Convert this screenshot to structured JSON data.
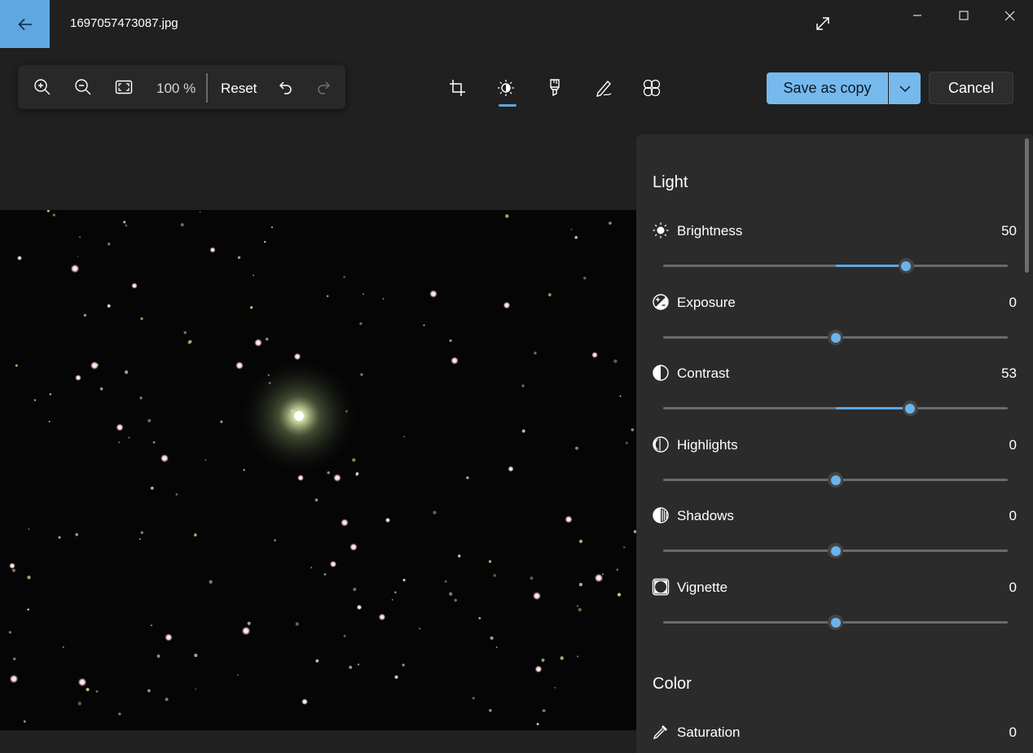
{
  "window": {
    "file_name": "1697057473087.jpg"
  },
  "toolbar": {
    "zoom_level": "100 %",
    "reset_label": "Reset"
  },
  "tabs": [
    {
      "icon": "crop-icon",
      "selected": false
    },
    {
      "icon": "adjust-icon",
      "selected": true
    },
    {
      "icon": "markup-icon",
      "selected": false
    },
    {
      "icon": "retouch-icon",
      "selected": false
    },
    {
      "icon": "filter-icon",
      "selected": false
    }
  ],
  "actions": {
    "save_label": "Save as copy",
    "cancel_label": "Cancel"
  },
  "panel": {
    "light_title": "Light",
    "adjustments": [
      {
        "label": "Brightness",
        "value": 50,
        "display": "50",
        "icon": "brightness-icon"
      },
      {
        "label": "Exposure",
        "value": 0,
        "display": "0",
        "icon": "exposure-icon"
      },
      {
        "label": "Contrast",
        "value": 53,
        "display": "53",
        "icon": "contrast-icon"
      },
      {
        "label": "Highlights",
        "value": 0,
        "display": "0",
        "icon": "highlights-icon"
      },
      {
        "label": "Shadows",
        "value": 0,
        "display": "0",
        "icon": "shadows-icon"
      },
      {
        "label": "Vignette",
        "value": 0,
        "display": "0",
        "icon": "vignette-icon"
      }
    ],
    "color_title": "Color",
    "color_adjustments": [
      {
        "label": "Saturation",
        "value": 0,
        "display": "0",
        "icon": "saturation-icon"
      }
    ]
  },
  "colors": {
    "accent": "#5ea7e0",
    "save_button": "#76b9ed",
    "background": "#202020",
    "panel": "#2b2b2b"
  }
}
